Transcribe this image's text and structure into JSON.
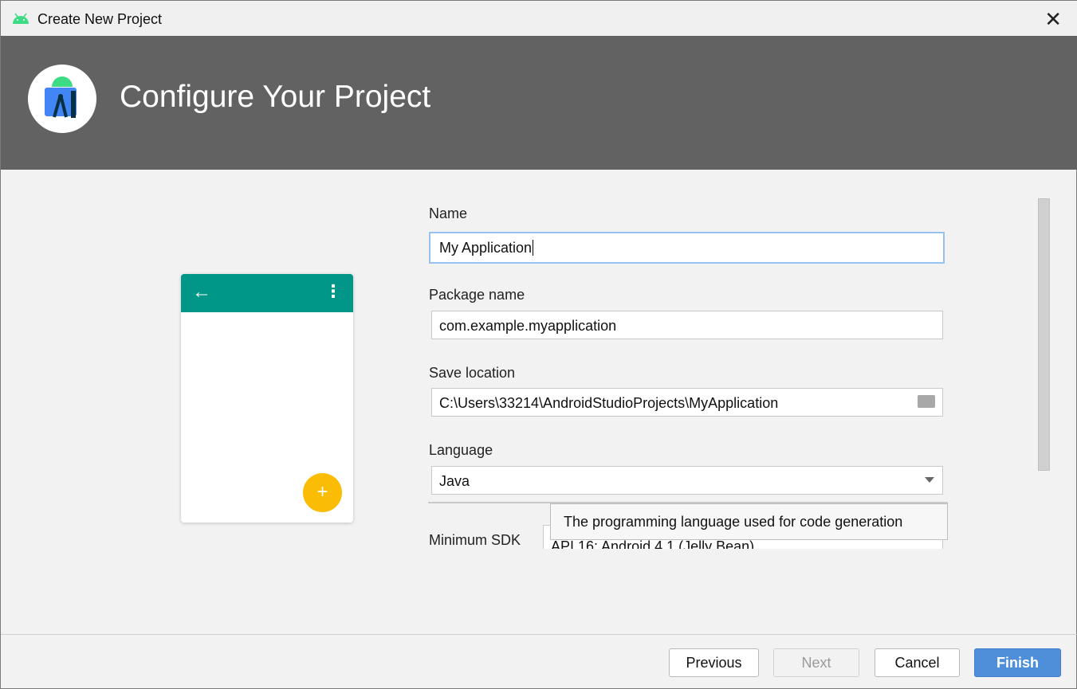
{
  "window": {
    "title": "Create New Project",
    "close": "✕"
  },
  "header": {
    "title": "Configure Your Project"
  },
  "form": {
    "name_label": "Name",
    "name_value": "My Application",
    "package_label": "Package name",
    "package_value": "com.example.myapplication",
    "location_label": "Save location",
    "location_value": "C:\\Users\\33214\\AndroidStudioProjects\\MyApplication",
    "language_label": "Language",
    "language_value": "Java",
    "min_sdk_label": "Minimum SDK",
    "min_sdk_value": "API 16: Android 4.1 (Jelly Bean)"
  },
  "tooltip": "The programming language used for code generation",
  "preview": {
    "fab": "+",
    "accent": "#009688",
    "fab_color": "#fbbc05"
  },
  "buttons": {
    "previous": "Previous",
    "next": "Next",
    "cancel": "Cancel",
    "finish": "Finish"
  }
}
